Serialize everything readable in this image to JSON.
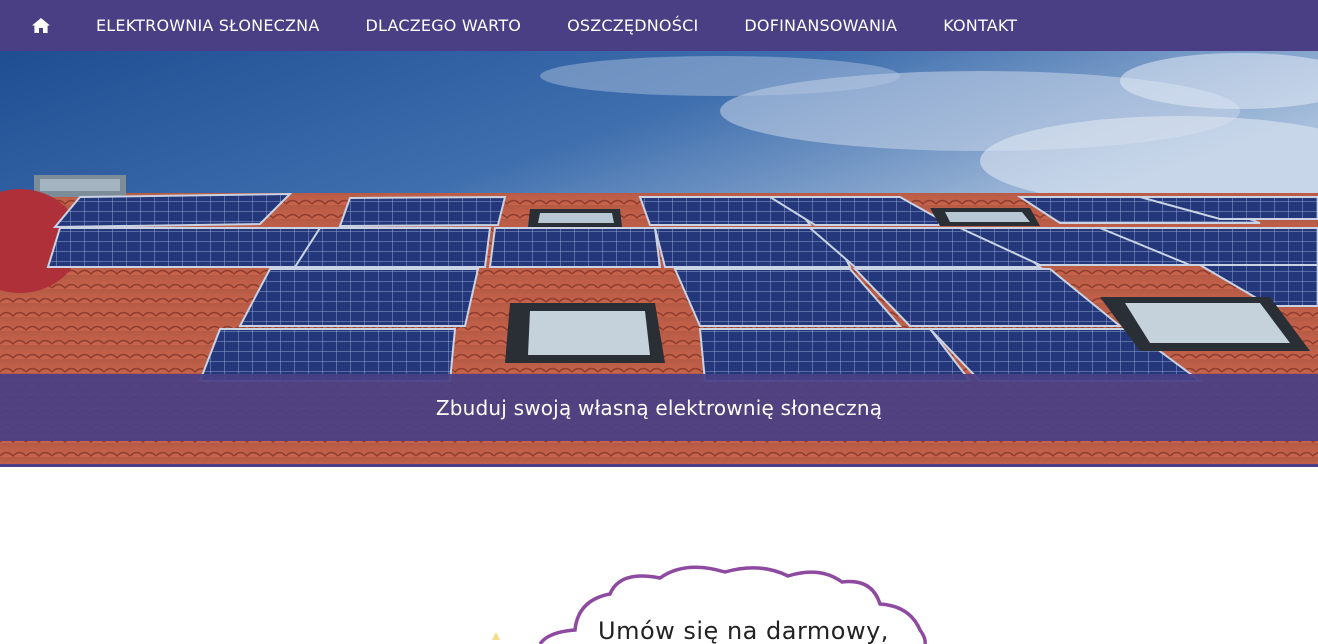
{
  "nav": {
    "home_icon": "home-icon",
    "items": [
      {
        "label": "ELEKTROWNIA SŁONECZNA"
      },
      {
        "label": "DLACZEGO WARTO"
      },
      {
        "label": "OSZCZĘDNOŚCI"
      },
      {
        "label": "DOFINANSOWANIA"
      },
      {
        "label": "KONTAKT"
      }
    ]
  },
  "hero": {
    "caption": "Zbuduj swoją własną elektrownię słoneczną",
    "image": "solar-panels-on-roof-photo"
  },
  "promo": {
    "cloud_text": "Umów się na darmowy,"
  },
  "colors": {
    "brand_purple": "#4a3f84",
    "cloud_outline": "#8e4aa0"
  }
}
